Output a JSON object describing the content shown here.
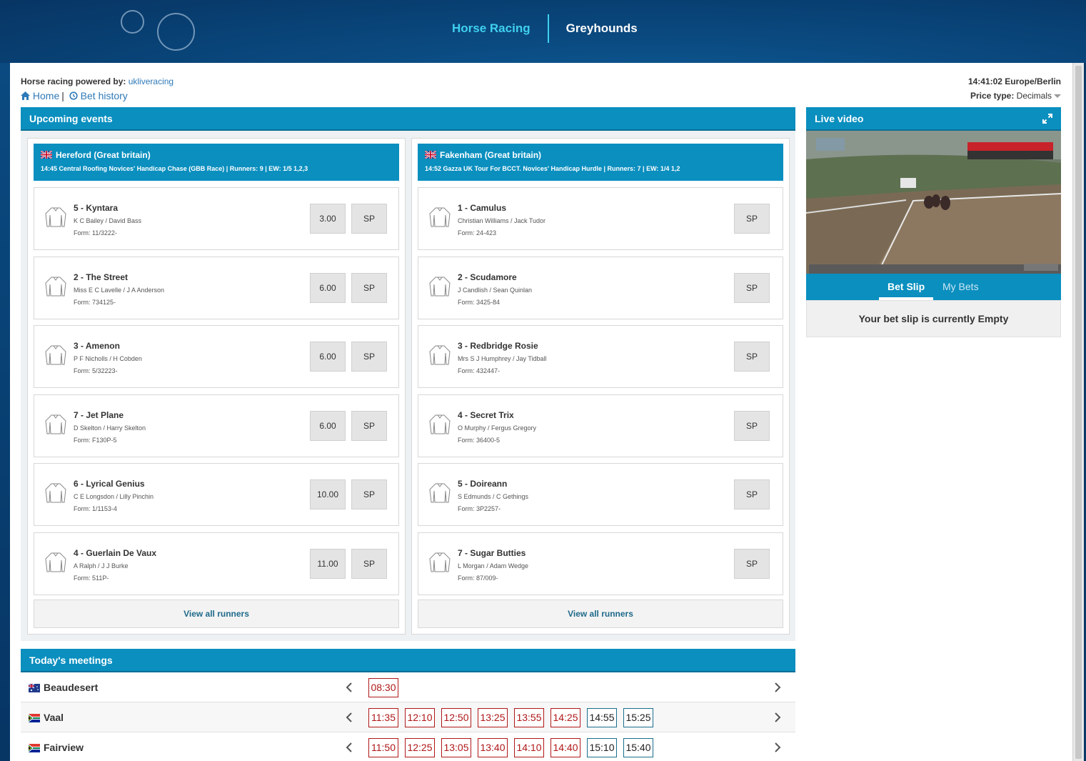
{
  "nav": {
    "horse_racing": "Horse Racing",
    "greyhounds": "Greyhounds"
  },
  "header": {
    "powered_label": "Horse racing powered by:",
    "powered_link": "ukliveracing",
    "home": "Home",
    "bet_history": "Bet history",
    "clock": "14:41:02 Europe/Berlin",
    "price_type_label": "Price type:",
    "price_type_value": "Decimals"
  },
  "upcoming": {
    "title": "Upcoming events",
    "events": [
      {
        "course": "Hereford (Great britain)",
        "details": "14:45 Central Roofing Novices' Handicap Chase (GBB Race) | Runners: 9 | EW: 1/5 1,2,3",
        "runners": [
          {
            "name": "5 - Kyntara",
            "jockey": "K C Bailey / David Bass",
            "form": "Form: 11/3222-",
            "price": "3.00",
            "sp": "SP"
          },
          {
            "name": "2 - The Street",
            "jockey": "Miss E C Lavelle / J A Anderson",
            "form": "Form: 734125-",
            "price": "6.00",
            "sp": "SP"
          },
          {
            "name": "3 - Amenon",
            "jockey": "P F Nicholls / H Cobden",
            "form": "Form: 5/32223-",
            "price": "6.00",
            "sp": "SP"
          },
          {
            "name": "7 - Jet Plane",
            "jockey": "D Skelton / Harry Skelton",
            "form": "Form: F130P-5",
            "price": "6.00",
            "sp": "SP"
          },
          {
            "name": "6 - Lyrical Genius",
            "jockey": "C E Longsdon / Lilly Pinchin",
            "form": "Form: 1/1153-4",
            "price": "10.00",
            "sp": "SP"
          },
          {
            "name": "4 - Guerlain De Vaux",
            "jockey": "A Ralph / J J Burke",
            "form": "Form: 511P-",
            "price": "11.00",
            "sp": "SP"
          }
        ],
        "view_all": "View all runners"
      },
      {
        "course": "Fakenham (Great britain)",
        "details": "14:52 Gazza UK Tour For BCCT. Novices' Handicap Hurdle | Runners: 7 | EW: 1/4 1,2",
        "runners": [
          {
            "name": "1 - Camulus",
            "jockey": "Christian Williams / Jack Tudor",
            "form": "Form: 24-423",
            "sp": "SP"
          },
          {
            "name": "2 - Scudamore",
            "jockey": "J Candlish / Sean Quinlan",
            "form": "Form: 3425-84",
            "sp": "SP"
          },
          {
            "name": "3 - Redbridge Rosie",
            "jockey": "Mrs S J Humphrey / Jay Tidball",
            "form": "Form: 432447-",
            "sp": "SP"
          },
          {
            "name": "4 - Secret Trix",
            "jockey": "O Murphy / Fergus Gregory",
            "form": "Form: 36400-5",
            "sp": "SP"
          },
          {
            "name": "5 - Doireann",
            "jockey": "S Edmunds / C Gethings",
            "form": "Form: 3P2257-",
            "sp": "SP"
          },
          {
            "name": "7 - Sugar Butties",
            "jockey": "L Morgan / Adam Wedge",
            "form": "Form: 87/009-",
            "sp": "SP"
          }
        ],
        "view_all": "View all runners"
      }
    ]
  },
  "live_video": {
    "title": "Live video"
  },
  "bet_slip": {
    "tab_active": "Bet Slip",
    "tab_other": "My Bets",
    "empty": "Your bet slip is currently Empty"
  },
  "meetings": {
    "title": "Today's meetings",
    "rows": [
      {
        "name": "Beaudesert",
        "flag": "australia-flag",
        "times": [
          {
            "t": "08:30",
            "state": "past"
          }
        ]
      },
      {
        "name": "Vaal",
        "flag": "south-africa-flag",
        "times": [
          {
            "t": "11:35",
            "state": "past"
          },
          {
            "t": "12:10",
            "state": "past"
          },
          {
            "t": "12:50",
            "state": "past"
          },
          {
            "t": "13:25",
            "state": "past"
          },
          {
            "t": "13:55",
            "state": "past"
          },
          {
            "t": "14:25",
            "state": "past"
          },
          {
            "t": "14:55",
            "state": "future"
          },
          {
            "t": "15:25",
            "state": "future"
          }
        ]
      },
      {
        "name": "Fairview",
        "flag": "south-africa-flag",
        "times": [
          {
            "t": "11:50",
            "state": "past"
          },
          {
            "t": "12:25",
            "state": "past"
          },
          {
            "t": "13:05",
            "state": "past"
          },
          {
            "t": "13:40",
            "state": "past"
          },
          {
            "t": "14:10",
            "state": "past"
          },
          {
            "t": "14:40",
            "state": "past"
          },
          {
            "t": "15:10",
            "state": "future"
          },
          {
            "t": "15:40",
            "state": "future"
          }
        ]
      }
    ]
  },
  "colors": {
    "accent": "#0a8fbf",
    "nav_active": "#3fd0f0",
    "past_time": "#b01818",
    "future_time_border": "#1a6f8c"
  }
}
